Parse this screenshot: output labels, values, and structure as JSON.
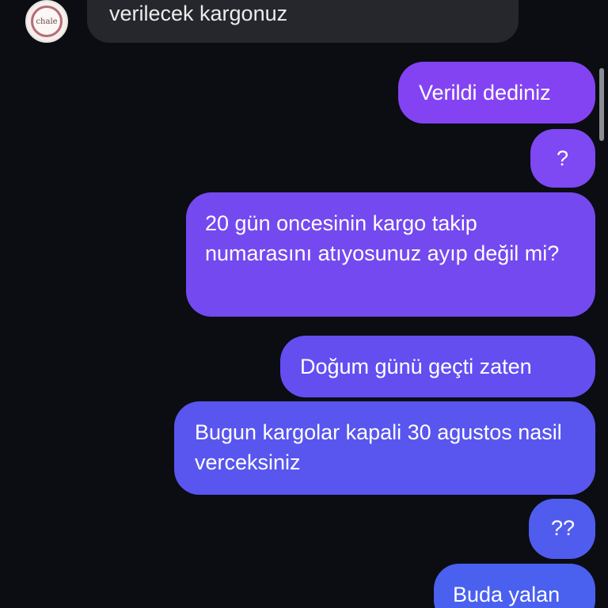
{
  "contact": {
    "avatar_text": "chale"
  },
  "messages": [
    {
      "direction": "incoming",
      "text": "verilecek kargonuz"
    },
    {
      "direction": "outgoing",
      "text": "Verildi dediniz"
    },
    {
      "direction": "outgoing",
      "text": "?"
    },
    {
      "direction": "outgoing",
      "text": "20 gün oncesinin kargo takip numarasını atıyosunuz ayıp değil mi?"
    },
    {
      "direction": "outgoing",
      "text": "Doğum günü geçti zaten"
    },
    {
      "direction": "outgoing",
      "text": "Bugun kargolar kapali 30 agustos nasil verceksiniz"
    },
    {
      "direction": "outgoing",
      "text": "??"
    },
    {
      "direction": "outgoing",
      "text": "Buda yalan"
    }
  ],
  "colors": {
    "background": "#0b0d12",
    "incoming_bubble": "#25272d",
    "outgoing_gradient_top": "#8443f2",
    "outgoing_gradient_bottom": "#4a60ee"
  }
}
